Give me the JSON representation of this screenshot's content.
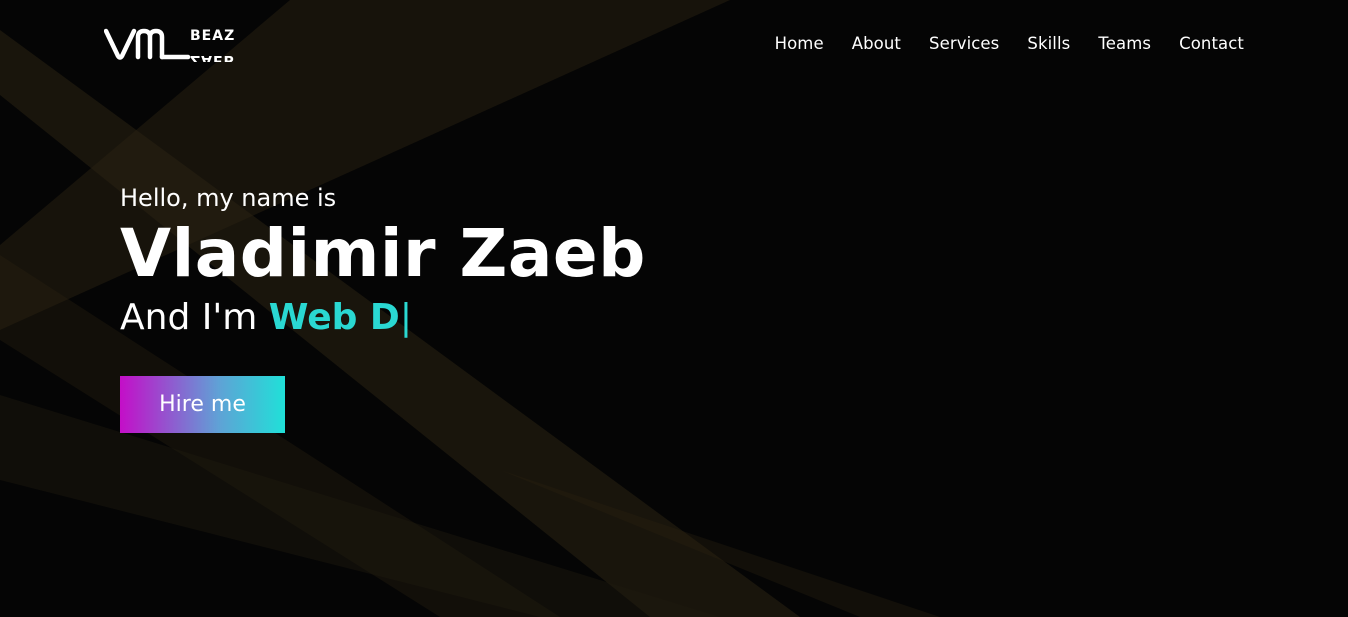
{
  "brand": {
    "logo_mark": "VM",
    "logo_top_text": "BEAZ",
    "logo_bottom_text": "ZAEB"
  },
  "nav": {
    "items": [
      {
        "label": "Home"
      },
      {
        "label": "About"
      },
      {
        "label": "Services"
      },
      {
        "label": "Skills"
      },
      {
        "label": "Teams"
      },
      {
        "label": "Contact"
      }
    ]
  },
  "hero": {
    "greeting": "Hello, my name is",
    "name": "Vladimir Zaeb",
    "role_prefix": "And I'm",
    "role_typed": "Web D",
    "cursor": "|",
    "cta_label": "Hire me"
  },
  "colors": {
    "background": "#050505",
    "accent": "#2ad8d2",
    "button_gradient_start": "#c40ec8",
    "button_gradient_end": "#20e0d8",
    "beam": "#2a2212"
  }
}
